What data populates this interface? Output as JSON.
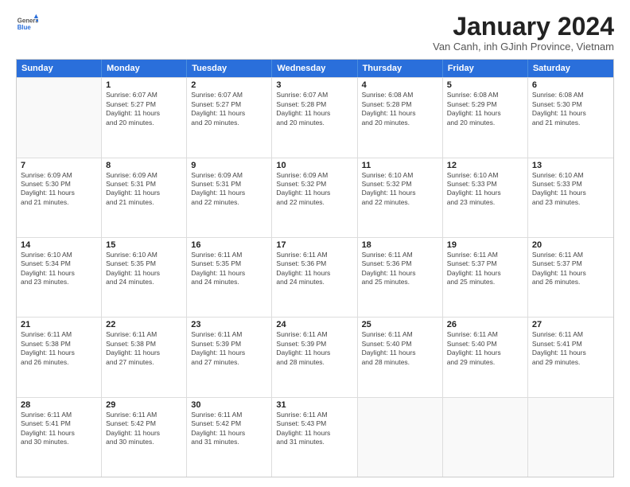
{
  "header": {
    "logo_general": "General",
    "logo_blue": "Blue",
    "title": "January 2024",
    "subtitle": "Van Canh, inh GJinh Province, Vietnam"
  },
  "days_of_week": [
    "Sunday",
    "Monday",
    "Tuesday",
    "Wednesday",
    "Thursday",
    "Friday",
    "Saturday"
  ],
  "weeks": [
    [
      {
        "day": "",
        "info": ""
      },
      {
        "day": "1",
        "info": "Sunrise: 6:07 AM\nSunset: 5:27 PM\nDaylight: 11 hours\nand 20 minutes."
      },
      {
        "day": "2",
        "info": "Sunrise: 6:07 AM\nSunset: 5:27 PM\nDaylight: 11 hours\nand 20 minutes."
      },
      {
        "day": "3",
        "info": "Sunrise: 6:07 AM\nSunset: 5:28 PM\nDaylight: 11 hours\nand 20 minutes."
      },
      {
        "day": "4",
        "info": "Sunrise: 6:08 AM\nSunset: 5:28 PM\nDaylight: 11 hours\nand 20 minutes."
      },
      {
        "day": "5",
        "info": "Sunrise: 6:08 AM\nSunset: 5:29 PM\nDaylight: 11 hours\nand 20 minutes."
      },
      {
        "day": "6",
        "info": "Sunrise: 6:08 AM\nSunset: 5:30 PM\nDaylight: 11 hours\nand 21 minutes."
      }
    ],
    [
      {
        "day": "7",
        "info": "Sunrise: 6:09 AM\nSunset: 5:30 PM\nDaylight: 11 hours\nand 21 minutes."
      },
      {
        "day": "8",
        "info": "Sunrise: 6:09 AM\nSunset: 5:31 PM\nDaylight: 11 hours\nand 21 minutes."
      },
      {
        "day": "9",
        "info": "Sunrise: 6:09 AM\nSunset: 5:31 PM\nDaylight: 11 hours\nand 22 minutes."
      },
      {
        "day": "10",
        "info": "Sunrise: 6:09 AM\nSunset: 5:32 PM\nDaylight: 11 hours\nand 22 minutes."
      },
      {
        "day": "11",
        "info": "Sunrise: 6:10 AM\nSunset: 5:32 PM\nDaylight: 11 hours\nand 22 minutes."
      },
      {
        "day": "12",
        "info": "Sunrise: 6:10 AM\nSunset: 5:33 PM\nDaylight: 11 hours\nand 23 minutes."
      },
      {
        "day": "13",
        "info": "Sunrise: 6:10 AM\nSunset: 5:33 PM\nDaylight: 11 hours\nand 23 minutes."
      }
    ],
    [
      {
        "day": "14",
        "info": "Sunrise: 6:10 AM\nSunset: 5:34 PM\nDaylight: 11 hours\nand 23 minutes."
      },
      {
        "day": "15",
        "info": "Sunrise: 6:10 AM\nSunset: 5:35 PM\nDaylight: 11 hours\nand 24 minutes."
      },
      {
        "day": "16",
        "info": "Sunrise: 6:11 AM\nSunset: 5:35 PM\nDaylight: 11 hours\nand 24 minutes."
      },
      {
        "day": "17",
        "info": "Sunrise: 6:11 AM\nSunset: 5:36 PM\nDaylight: 11 hours\nand 24 minutes."
      },
      {
        "day": "18",
        "info": "Sunrise: 6:11 AM\nSunset: 5:36 PM\nDaylight: 11 hours\nand 25 minutes."
      },
      {
        "day": "19",
        "info": "Sunrise: 6:11 AM\nSunset: 5:37 PM\nDaylight: 11 hours\nand 25 minutes."
      },
      {
        "day": "20",
        "info": "Sunrise: 6:11 AM\nSunset: 5:37 PM\nDaylight: 11 hours\nand 26 minutes."
      }
    ],
    [
      {
        "day": "21",
        "info": "Sunrise: 6:11 AM\nSunset: 5:38 PM\nDaylight: 11 hours\nand 26 minutes."
      },
      {
        "day": "22",
        "info": "Sunrise: 6:11 AM\nSunset: 5:38 PM\nDaylight: 11 hours\nand 27 minutes."
      },
      {
        "day": "23",
        "info": "Sunrise: 6:11 AM\nSunset: 5:39 PM\nDaylight: 11 hours\nand 27 minutes."
      },
      {
        "day": "24",
        "info": "Sunrise: 6:11 AM\nSunset: 5:39 PM\nDaylight: 11 hours\nand 28 minutes."
      },
      {
        "day": "25",
        "info": "Sunrise: 6:11 AM\nSunset: 5:40 PM\nDaylight: 11 hours\nand 28 minutes."
      },
      {
        "day": "26",
        "info": "Sunrise: 6:11 AM\nSunset: 5:40 PM\nDaylight: 11 hours\nand 29 minutes."
      },
      {
        "day": "27",
        "info": "Sunrise: 6:11 AM\nSunset: 5:41 PM\nDaylight: 11 hours\nand 29 minutes."
      }
    ],
    [
      {
        "day": "28",
        "info": "Sunrise: 6:11 AM\nSunset: 5:41 PM\nDaylight: 11 hours\nand 30 minutes."
      },
      {
        "day": "29",
        "info": "Sunrise: 6:11 AM\nSunset: 5:42 PM\nDaylight: 11 hours\nand 30 minutes."
      },
      {
        "day": "30",
        "info": "Sunrise: 6:11 AM\nSunset: 5:42 PM\nDaylight: 11 hours\nand 31 minutes."
      },
      {
        "day": "31",
        "info": "Sunrise: 6:11 AM\nSunset: 5:43 PM\nDaylight: 11 hours\nand 31 minutes."
      },
      {
        "day": "",
        "info": ""
      },
      {
        "day": "",
        "info": ""
      },
      {
        "day": "",
        "info": ""
      }
    ]
  ]
}
